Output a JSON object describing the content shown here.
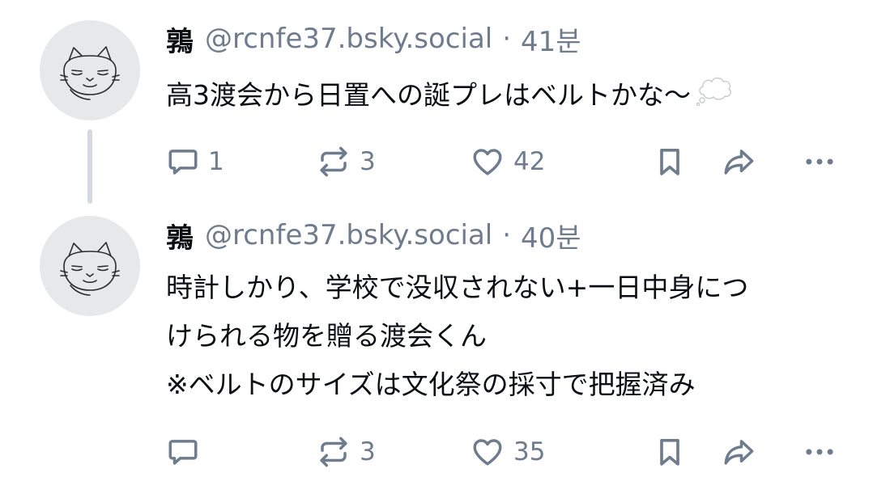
{
  "colors": {
    "text": "#0b0f14",
    "muted": "#6f7c8e",
    "avatar_bg": "#e7e8ea",
    "thread_line": "#d4d9e1"
  },
  "posts": [
    {
      "display_name": "鶉",
      "handle": "@rcnfe37.bsky.social",
      "separator": "·",
      "time": "41분",
      "text_lines": [
        "高3渡会から日置への誕プレはベルトかな～"
      ],
      "emoji": "thought-balloon-icon",
      "actions": {
        "reply_count": "1",
        "repost_count": "3",
        "like_count": "42"
      }
    },
    {
      "display_name": "鶉",
      "handle": "@rcnfe37.bsky.social",
      "separator": "·",
      "time": "40분",
      "text_lines": [
        "時計しかり、学校で没収されない+一日中身につ",
        "けられる物を贈る渡会くん",
        "※ベルトのサイズは文化祭の採寸で把握済み"
      ],
      "actions": {
        "reply_count": "",
        "repost_count": "3",
        "like_count": "35"
      }
    }
  ],
  "icons": {
    "avatar": "cat-sketch-avatar",
    "reply": "speech-bubble-icon",
    "repost": "repost-arrows-icon",
    "like": "heart-icon",
    "bookmark": "bookmark-icon",
    "share": "share-arrow-icon",
    "more": "ellipsis-icon"
  }
}
